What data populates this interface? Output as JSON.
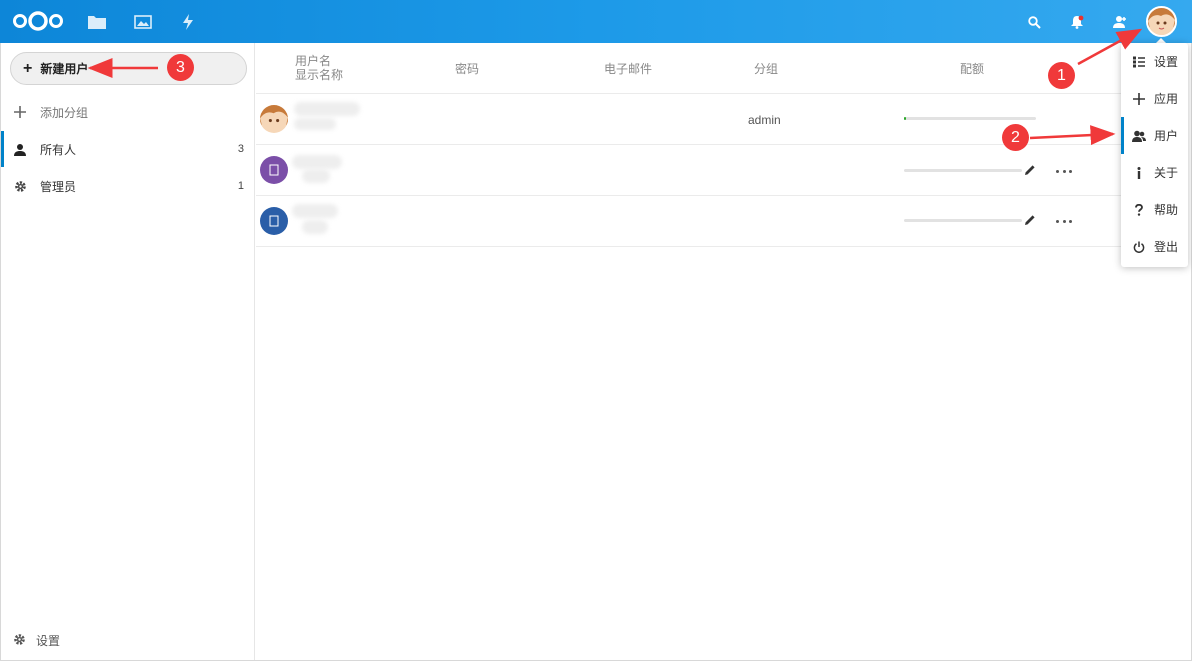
{
  "header": {
    "nav_icons": [
      "files-icon",
      "photos-icon",
      "activity-icon"
    ],
    "right_icons": [
      "search-icon",
      "notifications-icon",
      "contacts-icon"
    ],
    "brand_color": "#0082c9"
  },
  "sidebar": {
    "new_user_label": "新建用户",
    "add_group_label": "添加分组",
    "groups": [
      {
        "label": "所有人",
        "count": "3",
        "icon": "user-icon",
        "active": true
      },
      {
        "label": "管理员",
        "count": "1",
        "icon": "gear-icon",
        "active": false
      }
    ],
    "settings_label": "设置"
  },
  "table": {
    "headers": {
      "username": "用户名",
      "display_name": "显示名称",
      "password": "密码",
      "email": "电子邮件",
      "groups": "分组",
      "quota": "配额"
    },
    "rows": [
      {
        "avatar": "photo",
        "group": "admin",
        "quota_fraction": 0.01
      },
      {
        "avatar": "letter",
        "avatar_color": "#7b4fa8",
        "group": "",
        "quota_fraction": 0
      },
      {
        "avatar": "letter",
        "avatar_color": "#2a5ea8",
        "group": "",
        "quota_fraction": 0
      }
    ]
  },
  "menu": {
    "items": [
      {
        "label": "设置",
        "icon": "settings-list-icon"
      },
      {
        "label": "应用",
        "icon": "plus-icon"
      },
      {
        "label": "用户",
        "icon": "users-icon",
        "active": true
      },
      {
        "label": "关于",
        "icon": "info-icon"
      },
      {
        "label": "帮助",
        "icon": "help-icon"
      },
      {
        "label": "登出",
        "icon": "power-icon"
      }
    ]
  },
  "annotations": {
    "labels": [
      "1",
      "2",
      "3"
    ],
    "color": "#f0393a"
  }
}
